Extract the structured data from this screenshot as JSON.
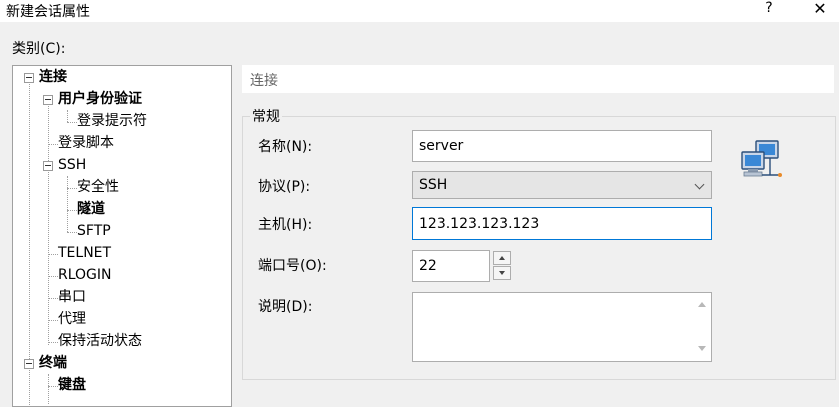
{
  "window": {
    "title": "新建会话属性",
    "help": "?",
    "close": "✕"
  },
  "category": {
    "label": "类别(C):"
  },
  "tree": {
    "items": [
      {
        "label": "连接"
      },
      {
        "label": "用户身份验证"
      },
      {
        "label": "登录提示符"
      },
      {
        "label": "登录脚本"
      },
      {
        "label": "SSH"
      },
      {
        "label": "安全性"
      },
      {
        "label": "隧道"
      },
      {
        "label": "SFTP"
      },
      {
        "label": "TELNET"
      },
      {
        "label": "RLOGIN"
      },
      {
        "label": "串口"
      },
      {
        "label": "代理"
      },
      {
        "label": "保持活动状态"
      },
      {
        "label": "终端"
      },
      {
        "label": "键盘"
      }
    ]
  },
  "header": {
    "title": "连接"
  },
  "general": {
    "title": "常规",
    "name": {
      "label": "名称(N):",
      "value": "server"
    },
    "protocol": {
      "label": "协议(P):",
      "value": "SSH"
    },
    "host": {
      "label": "主机(H):",
      "value": "123.123.123.123"
    },
    "port": {
      "label": "端口号(O):",
      "value": "22"
    },
    "description": {
      "label": "说明(D):",
      "value": ""
    }
  },
  "icons": {
    "network": "network-computers-icon"
  },
  "colors": {
    "focus_border": "#0078d7",
    "tree_bg": "#ffffff",
    "dialog_bg": "#f0f0f0"
  }
}
